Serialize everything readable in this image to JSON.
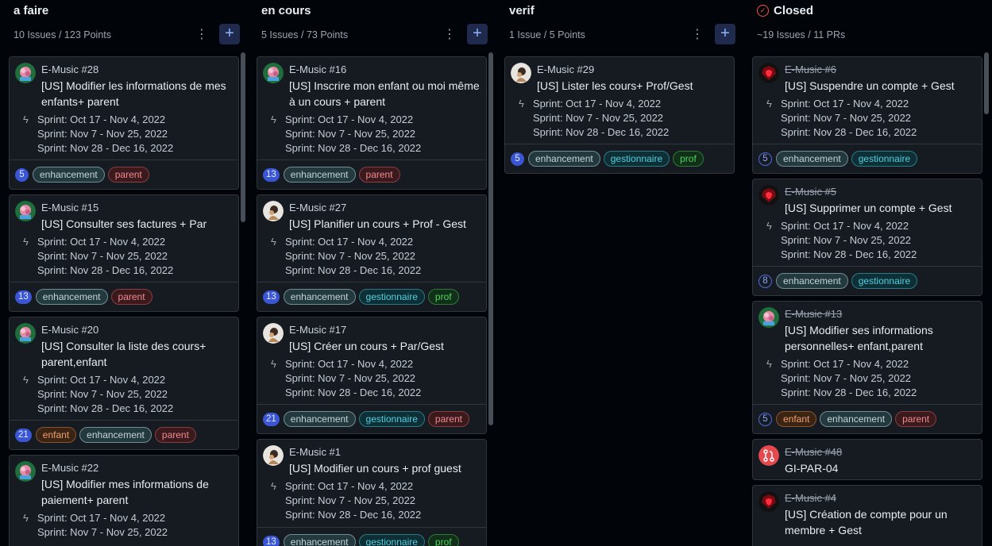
{
  "columns": [
    {
      "title": "a faire",
      "meta": "10 Issues / 123 Points",
      "cards": [
        {
          "repo": "E-Music #28",
          "title": "[US] Modifier les informations de mes enfants+ parent",
          "sprints": [
            "Sprint: Oct 17 - Nov 4, 2022",
            "Sprint: Nov 7 - Nov 25, 2022",
            "Sprint: Nov 28 - Dec 16, 2022"
          ],
          "points": "5",
          "labels": [
            "enhancement",
            "parent"
          ]
        },
        {
          "repo": "E-Music #15",
          "title": "[US] Consulter ses factures + Par",
          "sprints": [
            "Sprint: Oct 17 - Nov 4, 2022",
            "Sprint: Nov 7 - Nov 25, 2022",
            "Sprint: Nov 28 - Dec 16, 2022"
          ],
          "points": "13",
          "labels": [
            "enhancement",
            "parent"
          ]
        },
        {
          "repo": "E-Music #20",
          "title": "[US] Consulter la liste des cours+ parent,enfant",
          "sprints": [
            "Sprint: Oct 17 - Nov 4, 2022",
            "Sprint: Nov 7 - Nov 25, 2022",
            "Sprint: Nov 28 - Dec 16, 2022"
          ],
          "points": "21",
          "labels": [
            "enfant",
            "enhancement",
            "parent"
          ]
        },
        {
          "repo": "E-Music #22",
          "title": "[US] Modifier mes informations de paiement+ parent",
          "sprints": [
            "Sprint: Oct 17 - Nov 4, 2022",
            "Sprint: Nov 7 - Nov 25, 2022"
          ],
          "points": "",
          "labels": []
        }
      ]
    },
    {
      "title": "en cours",
      "meta": "5 Issues / 73 Points",
      "cards": [
        {
          "repo": "E-Music #16",
          "title": "[US] Inscrire mon enfant ou moi même à un cours + parent",
          "sprints": [
            "Sprint: Oct 17 - Nov 4, 2022",
            "Sprint: Nov 7 - Nov 25, 2022",
            "Sprint: Nov 28 - Dec 16, 2022"
          ],
          "points": "13",
          "labels": [
            "enhancement",
            "parent"
          ]
        },
        {
          "repo": "E-Music #27",
          "title": "[US] Planifier un cours + Prof - Gest",
          "sprints": [
            "Sprint: Oct 17 - Nov 4, 2022",
            "Sprint: Nov 7 - Nov 25, 2022",
            "Sprint: Nov 28 - Dec 16, 2022"
          ],
          "points": "13",
          "labels": [
            "enhancement",
            "gestionnaire",
            "prof"
          ]
        },
        {
          "repo": "E-Music #17",
          "title": "[US] Créer un cours + Par/Gest",
          "sprints": [
            "Sprint: Oct 17 - Nov 4, 2022",
            "Sprint: Nov 7 - Nov 25, 2022",
            "Sprint: Nov 28 - Dec 16, 2022"
          ],
          "points": "21",
          "labels": [
            "enhancement",
            "gestionnaire",
            "parent"
          ]
        },
        {
          "repo": "E-Music #1",
          "title": "[US] Modifier un cours + prof guest",
          "sprints": [
            "Sprint: Oct 17 - Nov 4, 2022",
            "Sprint: Nov 7 - Nov 25, 2022",
            "Sprint: Nov 28 - Dec 16, 2022"
          ],
          "points": "13",
          "labels": [
            "enhancement",
            "gestionnaire",
            "prof"
          ]
        }
      ]
    },
    {
      "title": "verif",
      "meta": "1 Issue / 5 Points",
      "cards": [
        {
          "repo": "E-Music #29",
          "title": "[US] Lister les cours+ Prof/Gest",
          "sprints": [
            "Sprint: Oct 17 - Nov 4, 2022",
            "Sprint: Nov 7 - Nov 25, 2022",
            "Sprint: Nov 28 - Dec 16, 2022"
          ],
          "points": "5",
          "labels": [
            "enhancement",
            "gestionnaire",
            "prof"
          ]
        }
      ]
    },
    {
      "title": "Closed",
      "meta": "~19 Issues / 11 PRs",
      "cards": [
        {
          "repo": "E-Music #6",
          "title": "[US] Suspendre un compte + Gest",
          "sprints": [
            "Sprint: Oct 17 - Nov 4, 2022",
            "Sprint: Nov 7 - Nov 25, 2022",
            "Sprint: Nov 28 - Dec 16, 2022"
          ],
          "points": "5",
          "labels": [
            "enhancement",
            "gestionnaire"
          ]
        },
        {
          "repo": "E-Music #5",
          "title": "[US] Supprimer un compte + Gest",
          "sprints": [
            "Sprint: Oct 17 - Nov 4, 2022",
            "Sprint: Nov 7 - Nov 25, 2022",
            "Sprint: Nov 28 - Dec 16, 2022"
          ],
          "points": "8",
          "labels": [
            "enhancement",
            "gestionnaire"
          ]
        },
        {
          "repo": "E-Music #13",
          "title": "[US] Modifier ses informations personnelles+ enfant,parent",
          "sprints": [
            "Sprint: Oct 17 - Nov 4, 2022",
            "Sprint: Nov 7 - Nov 25, 2022",
            "Sprint: Nov 28 - Dec 16, 2022"
          ],
          "points": "5",
          "labels": [
            "enfant",
            "enhancement",
            "parent"
          ]
        },
        {
          "repo": "E-Music #48",
          "title": "GI-PAR-04",
          "sprints": [],
          "points": "",
          "labels": []
        },
        {
          "repo": "E-Music #4",
          "title": "[US] Création de compte pour un membre + Gest",
          "sprints": [],
          "points": "",
          "labels": []
        }
      ]
    }
  ],
  "icons": {
    "menu": "kebab-icon",
    "add": "plus-icon",
    "sprint": "bolt-icon",
    "closed": "check-circle-icon"
  },
  "colors": {
    "accent": "#3a56d6",
    "closed": "#f85149",
    "background": "#010409",
    "card": "#161b22"
  }
}
